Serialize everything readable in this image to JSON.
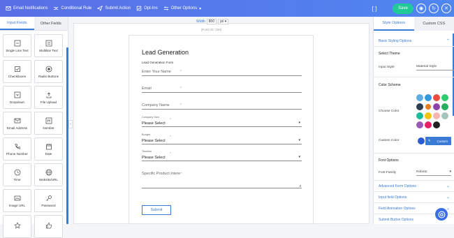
{
  "topbar": {
    "items": [
      {
        "icon": "mail-icon",
        "label": "Email Notifications"
      },
      {
        "icon": "shuffle-icon",
        "label": "Conditional Rule"
      },
      {
        "icon": "send-icon",
        "label": "Submit Action"
      },
      {
        "icon": "checkbox-icon",
        "label": "Opt-Ins"
      },
      {
        "icon": "sliders-icon",
        "label": "Other Options"
      }
    ],
    "save_label": "Save"
  },
  "left": {
    "tabs": [
      "Input Fields",
      "Other Fields"
    ],
    "fields": [
      {
        "label": "Single Line Text",
        "icon": "single-line-text-icon"
      },
      {
        "label": "Multiline Text",
        "icon": "multiline-text-icon"
      },
      {
        "label": "Checkboxes",
        "icon": "checkbox-icon"
      },
      {
        "label": "Radio Buttons",
        "icon": "radio-icon"
      },
      {
        "label": "Dropdown",
        "icon": "dropdown-icon"
      },
      {
        "label": "File Upload",
        "icon": "upload-icon"
      },
      {
        "label": "Email Address",
        "icon": "email-icon"
      },
      {
        "label": "Number",
        "icon": "number-icon"
      },
      {
        "label": "Phone Number",
        "icon": "phone-icon"
      },
      {
        "label": "Date",
        "icon": "calendar-icon"
      },
      {
        "label": "Time",
        "icon": "clock-icon"
      },
      {
        "label": "Website/URL",
        "icon": "globe-icon"
      },
      {
        "label": "Image URL",
        "icon": "image-icon"
      },
      {
        "label": "Password",
        "icon": "key-icon"
      },
      {
        "label": "",
        "icon": "star-icon"
      },
      {
        "label": "",
        "icon": "thumbs-up-icon"
      }
    ]
  },
  "canvas": {
    "width_label": "Width",
    "width_value": "800",
    "width_unit": "px",
    "form_id": "(Form ID: 100)"
  },
  "form": {
    "title": "Lead Generation",
    "subtitle": "Lead Generation Form",
    "fields": {
      "name": "Enter Your Name",
      "email": "Email",
      "company": "Company Name"
    },
    "selects": {
      "size_label": "Company Size",
      "size_value": "Please Select",
      "budget_label": "Budget",
      "budget_value": "Please Select",
      "timeline_label": "Timeline",
      "timeline_value": "Please Select"
    },
    "textarea": "Specific Product Intere",
    "required_mark": "*",
    "submit": "Submit"
  },
  "right": {
    "tabs": [
      "Style Options",
      "Custom CSS"
    ],
    "basic_styling": "Basic Styling Options",
    "select_theme": "Select Theme",
    "input_style_label": "Input Style",
    "input_style_value": "Material Style",
    "color_scheme": "Color Scheme",
    "choose_color": "Choose Color",
    "colors": [
      "#5dade2",
      "#3498db",
      "#e74c3c",
      "#2ecc71",
      "#2c3e50",
      "#e67e22",
      "#8e44ad",
      "#27ae60",
      "#1abc9c",
      "#f1c40f",
      "#f5b7b1",
      "#a3c4bc",
      "#9b59b6",
      "#e91e63",
      "#222222"
    ],
    "custom_color_label": "Custom Color",
    "custom_button": "Custom",
    "font_options": "Font Options",
    "font_family_label": "Font Family",
    "font_family_value": "Roboto",
    "collapsed": [
      "Advanced Form Options",
      "Input field Options",
      "Field Animation Options",
      "Submit Button Options"
    ]
  }
}
